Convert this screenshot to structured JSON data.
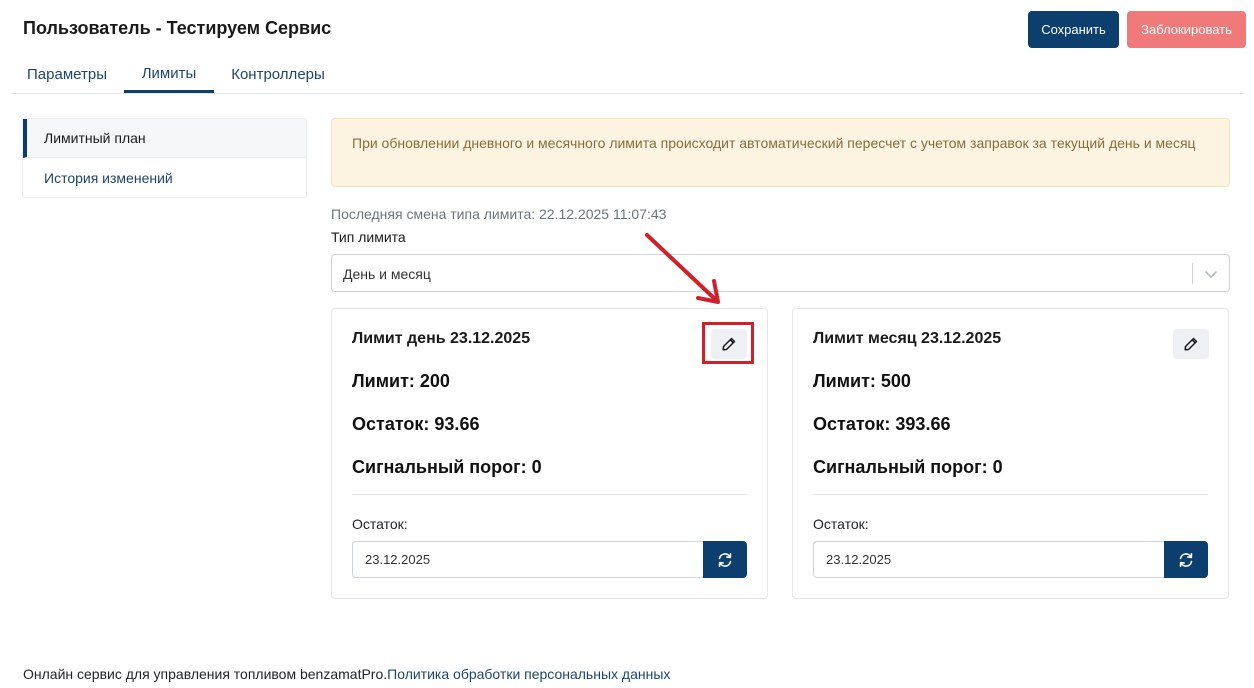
{
  "header": {
    "title": "Пользователь - Тестируем Сервис",
    "save_label": "Сохранить",
    "block_label": "Заблокировать"
  },
  "tabs": [
    {
      "label": "Параметры"
    },
    {
      "label": "Лимиты",
      "active": true
    },
    {
      "label": "Контроллеры"
    }
  ],
  "sidebar": {
    "items": [
      {
        "label": "Лимитный план",
        "active": true
      },
      {
        "label": "История изменений"
      }
    ]
  },
  "alert": {
    "text": "При обновлении дневного и месячного лимита происходит автоматический пересчет с учетом заправок за текущий день и месяц"
  },
  "limits": {
    "last_change": "Последняя смена типа лимита: 22.12.2025 11:07:43",
    "type_label": "Тип лимита",
    "type_value": "День и месяц",
    "day": {
      "title": "Лимит день 23.12.2025",
      "limit": "Лимит: 200",
      "rest": "Остаток: 93.66",
      "signal": "Сигнальный порог: 0",
      "rest_label": "Остаток:",
      "date": "23.12.2025"
    },
    "month": {
      "title": "Лимит месяц 23.12.2025",
      "limit": "Лимит: 500",
      "rest": "Остаток: 393.66",
      "signal": "Сигнальный порог: 0",
      "rest_label": "Остаток:",
      "date": "23.12.2025"
    }
  },
  "footer": {
    "text": "Онлайн сервис для управления топливом benzamatPro.",
    "link": "Политика обработки персональных данных"
  },
  "icons": {
    "edit": "pencil-icon",
    "refresh": "refresh-icon",
    "dropdown": "chevron-down-icon"
  },
  "colors": {
    "primary": "#0c3f6e",
    "danger": "#f07a7a",
    "alert_bg": "#fdf3e1",
    "annotation": "#d0202a"
  }
}
